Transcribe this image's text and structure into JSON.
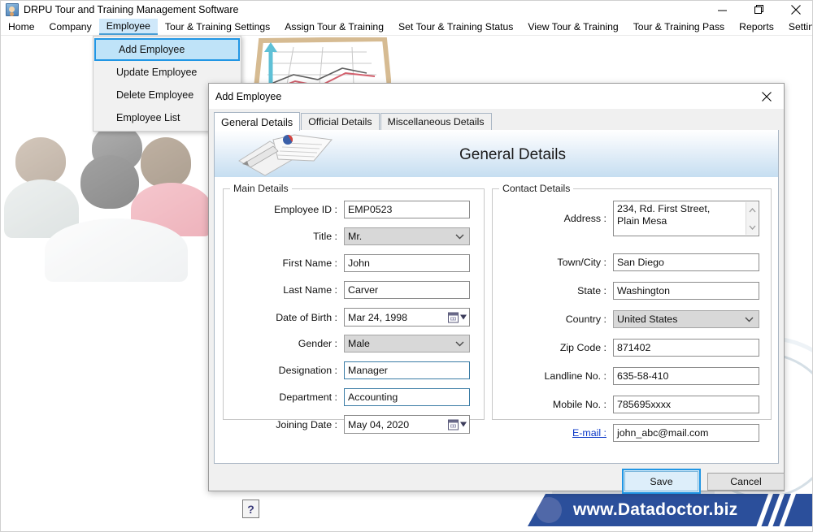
{
  "window": {
    "title": "DRPU Tour and Training Management Software",
    "icon": "app-icon",
    "controls": {
      "minimize": "minimize-icon",
      "maximize": "maximize-icon",
      "close": "close-icon"
    }
  },
  "menubar": {
    "items": [
      {
        "label": "Home",
        "active": false
      },
      {
        "label": "Company",
        "active": false
      },
      {
        "label": "Employee",
        "active": true
      },
      {
        "label": "Tour & Training Settings",
        "active": false
      },
      {
        "label": "Assign Tour & Training",
        "active": false
      },
      {
        "label": "Set Tour & Training Status",
        "active": false
      },
      {
        "label": "View Tour & Training",
        "active": false
      },
      {
        "label": "Tour & Training Pass",
        "active": false
      },
      {
        "label": "Reports",
        "active": false
      },
      {
        "label": "Settings",
        "active": false
      },
      {
        "label": "Help",
        "active": false
      }
    ]
  },
  "dropdown": {
    "items": [
      {
        "label": "Add Employee",
        "selected": true
      },
      {
        "label": "Update Employee",
        "selected": false
      },
      {
        "label": "Delete Employee",
        "selected": false
      },
      {
        "label": "Employee List",
        "selected": false
      }
    ]
  },
  "dialog": {
    "title": "Add Employee",
    "close_icon": "close-icon",
    "tabs": [
      {
        "label": "General Details",
        "active": true
      },
      {
        "label": "Official Details",
        "active": false
      },
      {
        "label": "Miscellaneous Details",
        "active": false
      }
    ],
    "panel_title": "General Details",
    "panel_icon": "notebook-pen-icon",
    "main_details": {
      "legend": "Main Details",
      "fields": [
        {
          "label": "Employee ID :",
          "value": "EMP0523",
          "type": "text"
        },
        {
          "label": "Title :",
          "value": "Mr.",
          "type": "combo"
        },
        {
          "label": "First Name :",
          "value": "John",
          "type": "text"
        },
        {
          "label": "Last Name :",
          "value": "Carver",
          "type": "text"
        },
        {
          "label": "Date of Birth :",
          "value": "Mar 24, 1998",
          "type": "date"
        },
        {
          "label": "Gender :",
          "value": "Male",
          "type": "combo"
        },
        {
          "label": "Designation :",
          "value": "Manager",
          "type": "text-focus"
        },
        {
          "label": "Department :",
          "value": "Accounting",
          "type": "text-focus"
        },
        {
          "label": "Joining Date :",
          "value": "May 04, 2020",
          "type": "date"
        }
      ],
      "help_label": "?"
    },
    "contact_details": {
      "legend": "Contact Details",
      "fields": [
        {
          "label": "Address :",
          "value": "234, Rd. First Street,\nPlain Mesa",
          "type": "textarea"
        },
        {
          "label": "Town/City :",
          "value": "San Diego",
          "type": "text"
        },
        {
          "label": "State :",
          "value": "Washington",
          "type": "text"
        },
        {
          "label": "Country :",
          "value": "United States",
          "type": "combo"
        },
        {
          "label": "Zip Code :",
          "value": "871402",
          "type": "text"
        },
        {
          "label": "Landline No. :",
          "value": "635-58-410",
          "type": "text"
        },
        {
          "label": "Mobile No. :",
          "value": "785695xxxx",
          "type": "text"
        },
        {
          "label": "E-mail :",
          "value": "john_abc@mail.com",
          "type": "text",
          "label_is_link": true
        }
      ]
    },
    "buttons": {
      "save": "Save",
      "cancel": "Cancel"
    }
  },
  "footer": {
    "url": "www.Datadoctor.biz"
  },
  "colors": {
    "accent": "#2196e4",
    "menu_active_bg": "#cfe8fa",
    "banner_bg": "#2b4f9b",
    "link": "#0b38c8",
    "focus_field_border": "#3a7ca5"
  }
}
